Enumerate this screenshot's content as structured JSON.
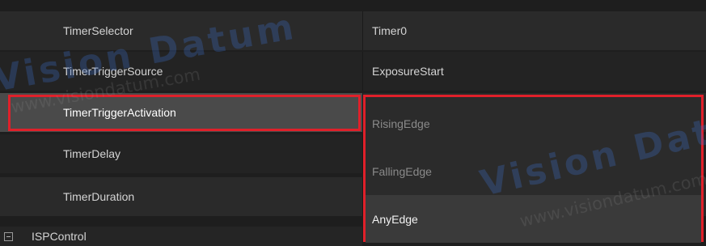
{
  "properties": [
    {
      "name": "TimerSelector",
      "value": "Timer0"
    },
    {
      "name": "TimerTriggerSource",
      "value": "ExposureStart"
    },
    {
      "name": "TimerTriggerActivation",
      "value": ""
    },
    {
      "name": "TimerDelay",
      "value": ""
    },
    {
      "name": "TimerDuration",
      "value": ""
    }
  ],
  "dropdown": {
    "options": [
      "RisingEdge",
      "FallingEdge",
      "AnyEdge"
    ],
    "selected": "AnyEdge"
  },
  "category": {
    "label": "ISPControl",
    "toggle_icon": "collapse-icon"
  },
  "watermark": {
    "brand": "Vision Datum",
    "url": "www.visiondatum.com"
  },
  "colors": {
    "highlight": "#e0202a",
    "background": "#1e1e1e"
  }
}
